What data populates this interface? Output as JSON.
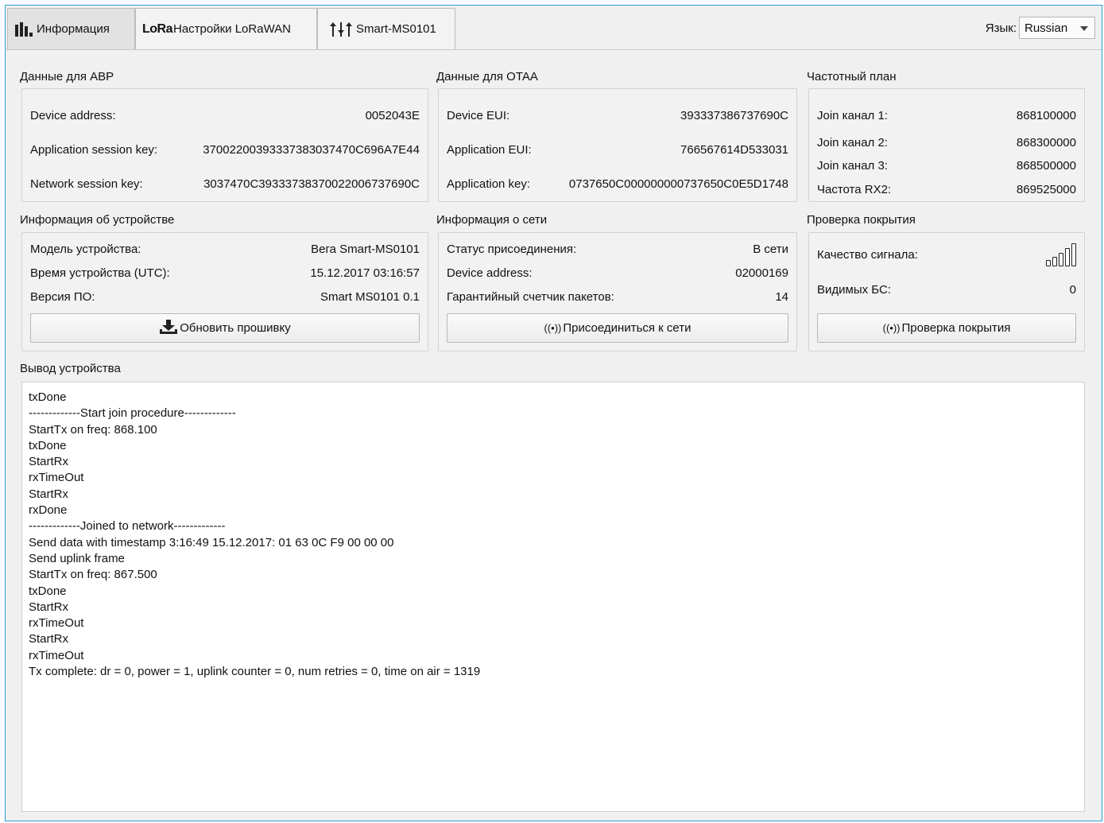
{
  "tabs": [
    {
      "label": "Информация",
      "icon": "bar-chart-icon",
      "active": true
    },
    {
      "label": "Настройки LoRaWAN",
      "icon": "lora-logo-icon",
      "logo_text": "LoRa",
      "active": false
    },
    {
      "label": "Smart-MS0101",
      "icon": "sliders-icon",
      "active": false
    }
  ],
  "language": {
    "label": "Язык:",
    "value": "Russian"
  },
  "abp": {
    "title": "Данные для ABP",
    "rows": [
      {
        "label": "Device address:",
        "value": "0052043E"
      },
      {
        "label": "Application session key:",
        "value": "3700220039333738303747 0C696A7E44"
      },
      {
        "label": "Network session key:",
        "value": "3037470C393337383700220067376 90C"
      }
    ]
  },
  "otaa": {
    "title": "Данные для OTAA",
    "rows": [
      {
        "label": "Device EUI:",
        "value": "393337386737690C"
      },
      {
        "label": "Application EUI:",
        "value": "766567614D533031"
      },
      {
        "label": "Application key:",
        "value": "0737650C000000000737650C0E5D1748"
      }
    ]
  },
  "freq": {
    "title": "Частотный план",
    "rows": [
      {
        "label": "Join канал 1:",
        "value": "868100000"
      },
      {
        "label": "Join канал 2:",
        "value": "868300000"
      },
      {
        "label": "Join канал 3:",
        "value": "868500000"
      },
      {
        "label": "Частота RX2:",
        "value": "869525000"
      }
    ]
  },
  "device": {
    "title": "Информация об устройстве",
    "rows": [
      {
        "label": "Модель устройства:",
        "value": "Вега Smart-MS0101"
      },
      {
        "label": "Время устройства (UTC):",
        "value": "15.12.2017 03:16:57"
      },
      {
        "label": "Версия ПО:",
        "value": "Smart MS0101 0.1"
      }
    ],
    "button": "Обновить прошивку"
  },
  "network": {
    "title": "Информация о сети",
    "rows": [
      {
        "label": "Статус присоединения:",
        "value": "В сети"
      },
      {
        "label": "Device address:",
        "value": "02000169"
      },
      {
        "label": "Гарантийный счетчик пакетов:",
        "value": "14"
      }
    ],
    "button": "Присоединиться к сети",
    "button_icon_text": "((•))"
  },
  "coverage": {
    "title": "Проверка покрытия",
    "signal_label": "Качество сигнала:",
    "signal_level": 0,
    "signal_max": 5,
    "bs_label": "Видимых БС:",
    "bs_value": "0",
    "button": "Проверка покрытия",
    "button_icon_text": "((•))"
  },
  "output": {
    "title": "Вывод устройства",
    "lines": [
      "txDone",
      "-------------Start join procedure-------------",
      "StartTx on freq: 868.100",
      "txDone",
      "StartRx",
      "rxTimeOut",
      "StartRx",
      "rxDone",
      "-------------Joined to network-------------",
      "Send data with timestamp 3:16:49 15.12.2017: 01 63 0C F9 00 00 00",
      "Send uplink frame",
      "StartTx on freq: 867.500",
      "txDone",
      "StartRx",
      "rxTimeOut",
      "StartRx",
      "rxTimeOut",
      "Tx complete: dr = 0, power = 1, uplink counter = 0, num retries = 0, time on air = 1319"
    ]
  }
}
